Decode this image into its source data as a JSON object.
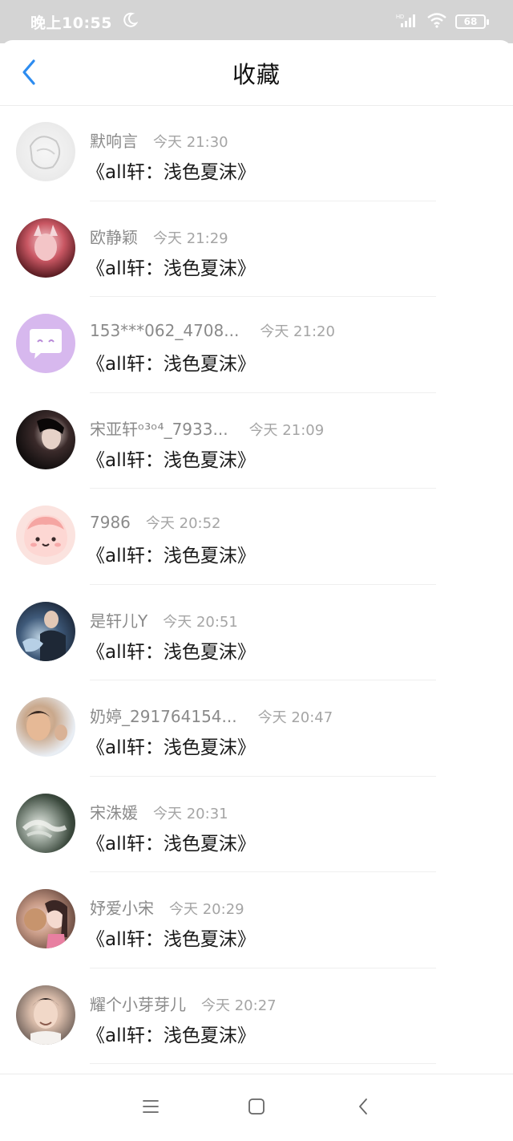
{
  "status_bar": {
    "time": "晚上10:55",
    "moon_icon": "moon-icon",
    "signal_label": "HD",
    "battery": "68"
  },
  "header": {
    "title": "收藏",
    "back_icon": "chevron-left-icon"
  },
  "items": [
    {
      "name": "默响言",
      "time": "今天 21:30",
      "title": "《all轩：浅色夏沫》"
    },
    {
      "name": "欧静颖",
      "time": "今天 21:29",
      "title": "《all轩：浅色夏沫》"
    },
    {
      "name": "153***062_4708...",
      "time": "今天 21:20",
      "title": "《all轩：浅色夏沫》"
    },
    {
      "name": "宋亚轩ᵒ³ᵒ⁴_7933...",
      "time": "今天 21:09",
      "title": "《all轩：浅色夏沫》"
    },
    {
      "name": "7986",
      "time": "今天 20:52",
      "title": "《all轩：浅色夏沫》"
    },
    {
      "name": "是轩儿Y",
      "time": "今天 20:51",
      "title": "《all轩：浅色夏沫》"
    },
    {
      "name": "奶婷_291764154...",
      "time": "今天 20:47",
      "title": "《all轩：浅色夏沫》"
    },
    {
      "name": "宋洙媛",
      "time": "今天 20:31",
      "title": "《all轩：浅色夏沫》"
    },
    {
      "name": "妤爱小宋",
      "time": "今天 20:29",
      "title": "《all轩：浅色夏沫》"
    },
    {
      "name": "耀个小芽芽儿",
      "time": "今天 20:27",
      "title": "《all轩：浅色夏沫》"
    }
  ],
  "nav": {
    "menu_icon": "menu-icon",
    "home_icon": "home-square-icon",
    "back_icon": "back-triangle-icon"
  },
  "colors": {
    "accent": "#2d8cf0",
    "status_bar_bg": "#d4d4d4",
    "username": "#8a8a8a",
    "timestamp": "#a5a5a5",
    "title_text": "#1a1a1a"
  }
}
